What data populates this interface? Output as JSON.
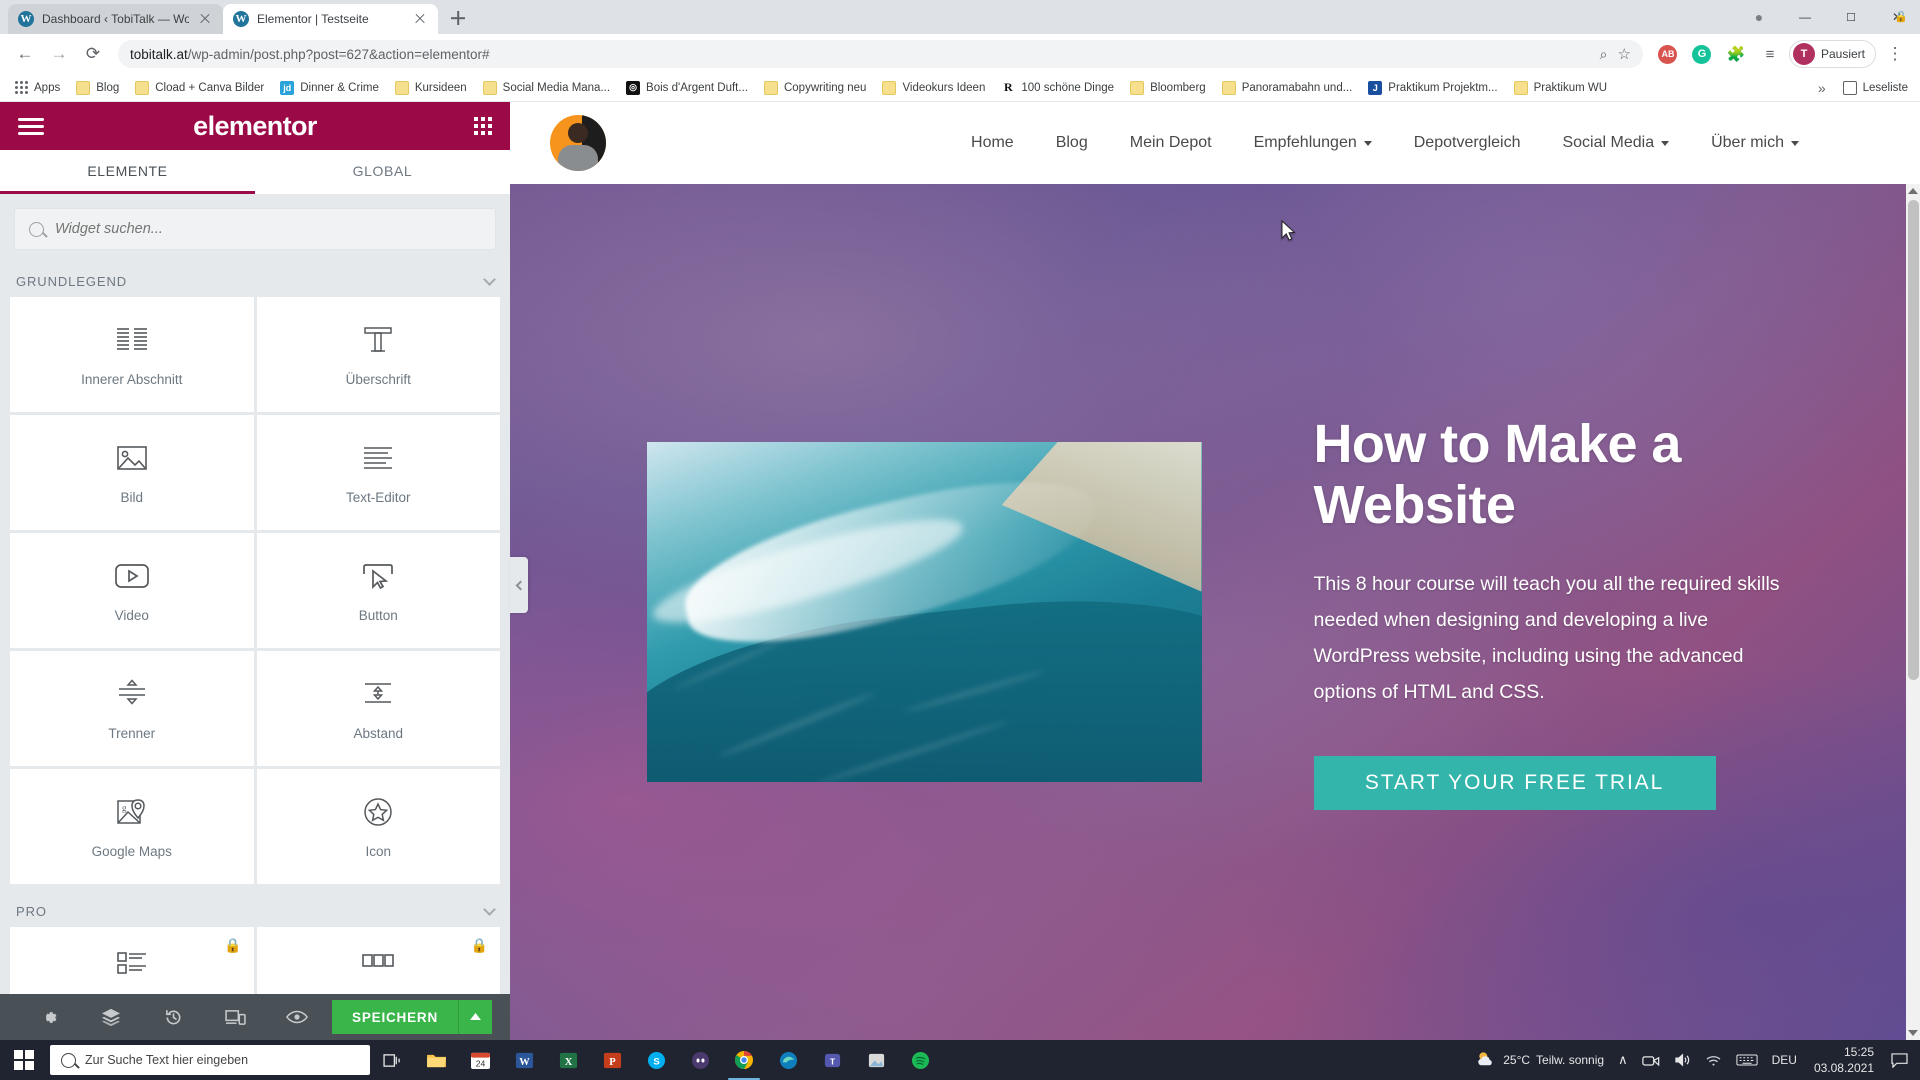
{
  "browser": {
    "tabs": [
      {
        "title": "Dashboard ‹ TobiTalk — WordPre",
        "active": false,
        "favicon": "wordpress-icon"
      },
      {
        "title": "Elementor | Testseite",
        "active": true,
        "favicon": "wordpress-icon"
      }
    ],
    "new_tab_label": "+",
    "window_controls": {
      "minimize": "—",
      "maximize": "▢",
      "close": "✕",
      "record": "●"
    },
    "nav": {
      "back": "←",
      "forward": "→",
      "reload": "⟳"
    },
    "omnibox": {
      "lock": "🔒",
      "url_host": "tobitalk.at",
      "url_path": "/wp-admin/post.php?post=627&action=elementor#",
      "zoom_icon": "search-zoom-icon",
      "star_icon": "☆"
    },
    "extensions": [
      "adblock-icon",
      "grammarly-icon",
      "puzzle-icon",
      "reading-list-icon"
    ],
    "profile": {
      "initial": "T",
      "label": "Pausiert"
    },
    "menu_icon": "⋮",
    "bookmarks": [
      {
        "label": "Apps",
        "icon": "apps-grid-icon"
      },
      {
        "label": "Blog",
        "icon": "folder-icon"
      },
      {
        "label": "Cload + Canva Bilder",
        "icon": "folder-icon"
      },
      {
        "label": "Dinner & Crime",
        "icon": "jd-icon",
        "icon_text": "jd",
        "icon_color": "#29a3d9"
      },
      {
        "label": "Kursideen",
        "icon": "folder-icon"
      },
      {
        "label": "Social Media Mana...",
        "icon": "folder-icon"
      },
      {
        "label": "Bois d'Argent Duft...",
        "icon": "dark-site-icon",
        "icon_text": "",
        "icon_color": "#111111"
      },
      {
        "label": "Copywriting neu",
        "icon": "folder-icon"
      },
      {
        "label": "Videokurs Ideen",
        "icon": "folder-icon"
      },
      {
        "label": "100 schöne Dinge",
        "icon": "r-icon",
        "icon_text": "R",
        "icon_color": "#ffffff"
      },
      {
        "label": "Bloomberg",
        "icon": "folder-icon"
      },
      {
        "label": "Panoramabahn und...",
        "icon": "folder-icon"
      },
      {
        "label": "Praktikum Projektm...",
        "icon": "j-icon",
        "icon_text": "J",
        "icon_color": "#1a4fa0"
      },
      {
        "label": "Praktikum WU",
        "icon": "folder-icon"
      }
    ],
    "bookmarks_overflow": "»",
    "reading_list": "Leseliste"
  },
  "elementor": {
    "brand": "elementor",
    "menu_icon": "hamburger-menu-icon",
    "grid_icon": "widgets-grid-icon",
    "tabs": [
      {
        "label": "ELEMENTE",
        "active": true
      },
      {
        "label": "GLOBAL",
        "active": false
      }
    ],
    "search": {
      "placeholder": "Widget suchen...",
      "value": "",
      "icon": "search-icon"
    },
    "categories": [
      {
        "title": "GRUNDLEGEND",
        "collapsed": false,
        "widgets": [
          {
            "label": "Innerer Abschnitt",
            "icon": "inner-section-icon",
            "locked": false
          },
          {
            "label": "Überschrift",
            "icon": "heading-t-icon",
            "locked": false
          },
          {
            "label": "Bild",
            "icon": "image-icon",
            "locked": false
          },
          {
            "label": "Text-Editor",
            "icon": "text-editor-icon",
            "locked": false
          },
          {
            "label": "Video",
            "icon": "video-play-icon",
            "locked": false
          },
          {
            "label": "Button",
            "icon": "button-cursor-icon",
            "locked": false
          },
          {
            "label": "Trenner",
            "icon": "divider-icon",
            "locked": false
          },
          {
            "label": "Abstand",
            "icon": "spacer-icon",
            "locked": false
          },
          {
            "label": "Google Maps",
            "icon": "google-maps-icon",
            "locked": false
          },
          {
            "label": "Icon",
            "icon": "star-circle-icon",
            "locked": false
          }
        ]
      },
      {
        "title": "PRO",
        "collapsed": false,
        "widgets": [
          {
            "label": "",
            "icon": "posts-list-icon",
            "locked": true
          },
          {
            "label": "",
            "icon": "portfolio-icon",
            "locked": true
          }
        ]
      }
    ],
    "footer": {
      "icons": [
        {
          "name": "settings-gear-icon",
          "glyph": "⚙"
        },
        {
          "name": "navigator-layers-icon",
          "glyph": "≋"
        },
        {
          "name": "history-icon",
          "glyph": "↺"
        },
        {
          "name": "responsive-mode-icon",
          "glyph": "▭"
        },
        {
          "name": "preview-eye-icon",
          "glyph": "👁"
        }
      ],
      "save_label": "SPEICHERN",
      "save_arrow": "▲"
    },
    "collapse_handle": "collapse-panel-icon"
  },
  "site": {
    "logo_alt": "profile-avatar",
    "menu": [
      {
        "label": "Home",
        "dropdown": false
      },
      {
        "label": "Blog",
        "dropdown": false
      },
      {
        "label": "Mein Depot",
        "dropdown": false
      },
      {
        "label": "Empfehlungen",
        "dropdown": true
      },
      {
        "label": "Depotvergleich",
        "dropdown": false
      },
      {
        "label": "Social Media",
        "dropdown": true
      },
      {
        "label": "Über mich",
        "dropdown": true
      }
    ],
    "hero": {
      "image_alt": "ocean-wave-aerial-photo",
      "heading": "How to Make a Website",
      "paragraph": "This 8 hour course will teach you all the required skills needed when designing and developing a live WordPress website, including using the advanced options of HTML and CSS.",
      "cta_label": "START YOUR FREE TRIAL",
      "cta_color": "#33b5ac"
    }
  },
  "taskbar": {
    "start_icon": "windows-start-icon",
    "search_placeholder": "Zur Suche Text hier eingeben",
    "search_icon": "search-icon",
    "buttons": [
      {
        "name": "task-view-icon",
        "glyph": "❐",
        "active": false
      },
      {
        "name": "file-explorer-icon",
        "glyph": "📁",
        "active": false
      },
      {
        "name": "calendar-24-icon",
        "glyph": "24",
        "active": false
      },
      {
        "name": "word-icon",
        "glyph": "W",
        "active": false
      },
      {
        "name": "excel-icon",
        "glyph": "X",
        "active": false
      },
      {
        "name": "powerpoint-icon",
        "glyph": "P",
        "active": false
      },
      {
        "name": "skype-icon",
        "glyph": "S",
        "active": false
      },
      {
        "name": "discord-icon",
        "glyph": "◉",
        "active": false
      },
      {
        "name": "chrome-icon",
        "glyph": "◎",
        "active": true
      },
      {
        "name": "edge-icon",
        "glyph": "e",
        "active": false
      },
      {
        "name": "teams-icon",
        "glyph": "T",
        "active": false
      },
      {
        "name": "photos-icon",
        "glyph": "▣",
        "active": false
      },
      {
        "name": "spotify-icon",
        "glyph": "♫",
        "active": false
      }
    ],
    "weather": {
      "icon": "partly-sunny-icon",
      "temp": "25°C",
      "text": "Teilw. sonnig"
    },
    "tray": [
      {
        "name": "show-hidden-icons",
        "glyph": "∧"
      },
      {
        "name": "meet-now-icon",
        "glyph": "🖭"
      },
      {
        "name": "volume-icon",
        "glyph": "🔊"
      },
      {
        "name": "wifi-icon",
        "glyph": "◗"
      },
      {
        "name": "keyboard-icon",
        "glyph": "⌨"
      }
    ],
    "language": "DEU",
    "clock": {
      "time": "15:25",
      "date": "03.08.2021"
    },
    "action_center": "notification-icon"
  }
}
